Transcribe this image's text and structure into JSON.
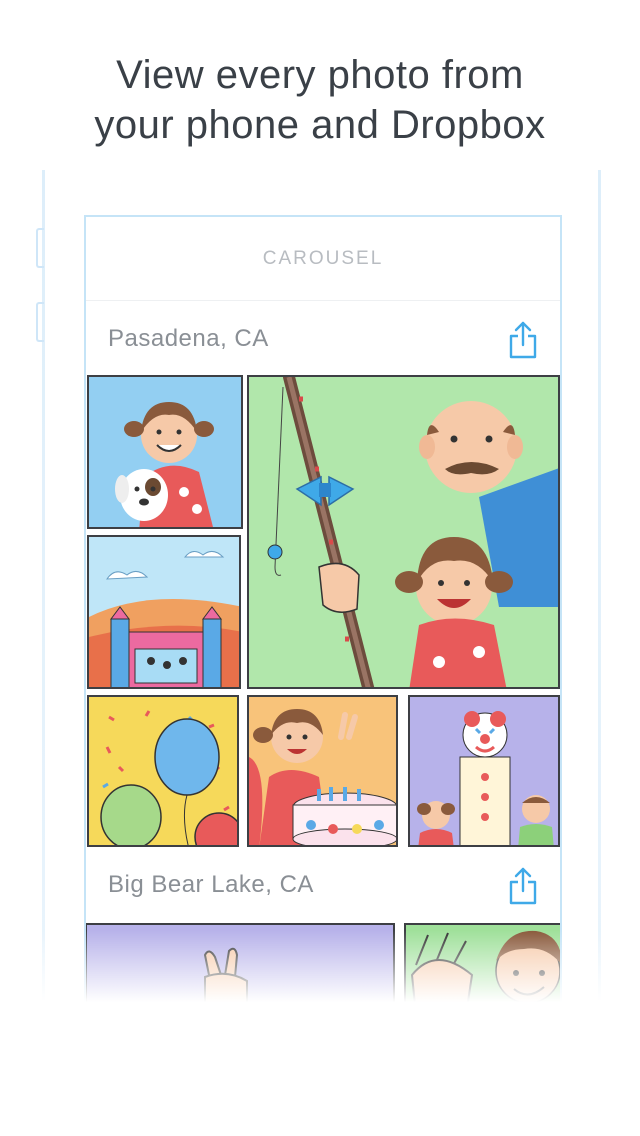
{
  "headline": {
    "line1": "View every photo from",
    "line2": "your phone and Dropbox"
  },
  "app": {
    "title": "CAROUSEL"
  },
  "sections": [
    {
      "location": "Pasadena, CA",
      "share_icon": "share-icon"
    },
    {
      "location": "Big Bear Lake, CA",
      "share_icon": "share-icon"
    }
  ],
  "photos": [
    {
      "name": "photo-girl-with-dog"
    },
    {
      "name": "photo-grandpa-fishing"
    },
    {
      "name": "photo-bounce-house"
    },
    {
      "name": "photo-balloons"
    },
    {
      "name": "photo-birthday-cake"
    },
    {
      "name": "photo-clown"
    },
    {
      "name": "photo-peace-sign"
    },
    {
      "name": "photo-waving-boy"
    }
  ],
  "colors": {
    "accent": "#3fa9e8",
    "outline": "#c5e4f7",
    "text": "#3a4047"
  }
}
